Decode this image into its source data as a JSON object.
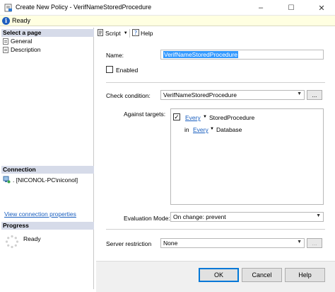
{
  "window": {
    "title": "Create New Policy - VerifNameStoredProcedure",
    "min_glyph": "–",
    "max_glyph": "☐",
    "close_glyph": "✕"
  },
  "status": {
    "text": "Ready"
  },
  "left": {
    "select_page_header": "Select a page",
    "pages": [
      {
        "label": "General"
      },
      {
        "label": "Description"
      }
    ],
    "connection_header": "Connection",
    "connection_text": ". [NICONOL-PC\\niconol]",
    "view_connection_link": "View connection properties",
    "progress_header": "Progress",
    "progress_status": "Ready"
  },
  "toolbar": {
    "script_label": "Script",
    "help_label": "Help"
  },
  "form": {
    "name_label": "Name:",
    "name_value": "VerifNameStoredProcedure",
    "enabled_label": "Enabled",
    "enabled_checked": false,
    "check_condition_label": "Check condition:",
    "check_condition_value": "VerifNameStoredProcedure",
    "ellipsis_label": "...",
    "against_targets_label": "Against targets:",
    "targets": {
      "row1_every": "Every",
      "row1_target": "StoredProcedure",
      "row2_in": "in",
      "row2_every": "Every",
      "row2_target": "Database"
    },
    "evaluation_mode_label": "Evaluation Mode:",
    "evaluation_mode_value": "On change: prevent",
    "server_restriction_label": "Server restriction",
    "server_restriction_value": "None"
  },
  "buttons": {
    "ok": "OK",
    "cancel": "Cancel",
    "help": "Help"
  },
  "colors": {
    "accent": "#0078d7",
    "link": "#1a5fbf",
    "status_bg": "#ffffe1",
    "section_bg": "#d6dbe9"
  }
}
